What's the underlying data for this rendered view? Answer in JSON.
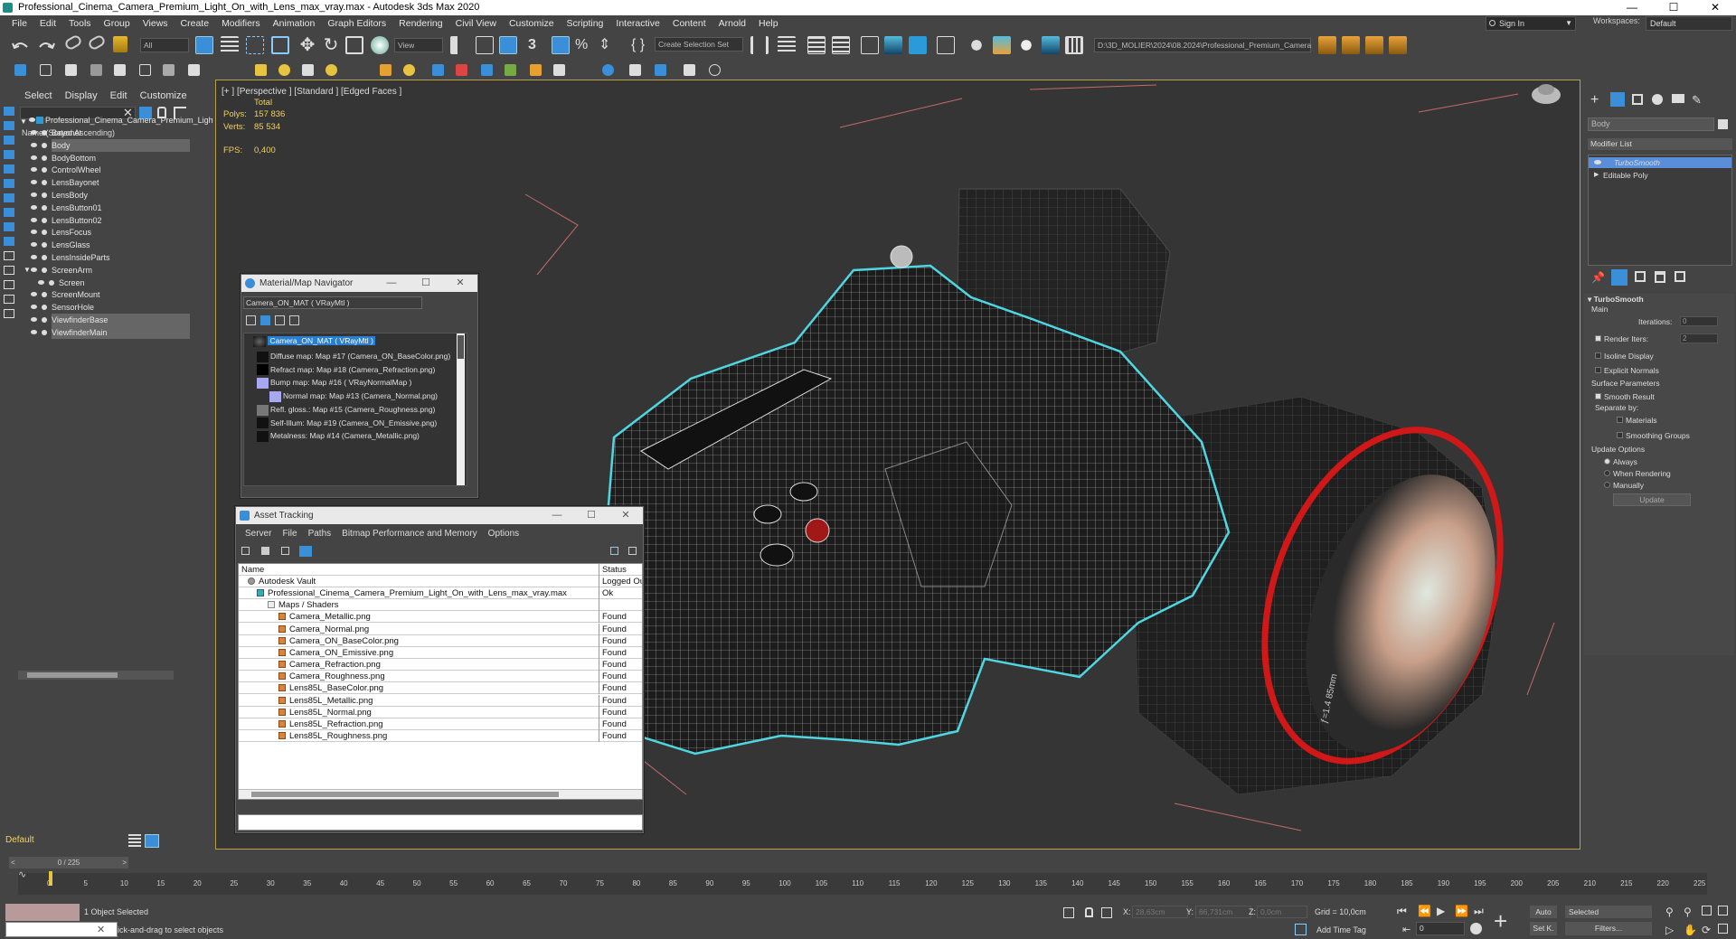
{
  "title": "Professional_Cinema_Camera_Premium_Light_On_with_Lens_max_vray.max - Autodesk 3ds Max 2020",
  "window_buttons": [
    "—",
    "☐",
    "✕"
  ],
  "menu": [
    "File",
    "Edit",
    "Tools",
    "Group",
    "Views",
    "Create",
    "Modifiers",
    "Animation",
    "Graph Editors",
    "Rendering",
    "Civil View",
    "Customize",
    "Scripting",
    "Interactive",
    "Content",
    "Arnold",
    "Help"
  ],
  "signin": "Sign In",
  "workspaces_label": "Workspaces:",
  "workspaces_value": "Default",
  "toolbar": {
    "filter": "All",
    "view": "View",
    "selection_set": "Create Selection Set",
    "path": "D:\\3D_MOLIER\\2024\\08.2024\\Professional_Premium_Camera"
  },
  "scene_explorer": {
    "tabs": [
      "Select",
      "Display",
      "Edit",
      "Customize"
    ],
    "header": "Name (Sorted Ascending)",
    "root": "Professional_Cinema_Camera_Premium_Light_On_with_Lens",
    "items": [
      {
        "name": "Bayonet",
        "selected": false
      },
      {
        "name": "Body",
        "selected": true
      },
      {
        "name": "BodyBottom",
        "selected": false
      },
      {
        "name": "ControlWheel",
        "selected": false
      },
      {
        "name": "LensBayonet",
        "selected": false
      },
      {
        "name": "LensBody",
        "selected": false
      },
      {
        "name": "LensButton01",
        "selected": false
      },
      {
        "name": "LensButton02",
        "selected": false
      },
      {
        "name": "LensFocus",
        "selected": false
      },
      {
        "name": "LensGlass",
        "selected": false
      },
      {
        "name": "LensInsideParts",
        "selected": false
      },
      {
        "name": "ScreenArm",
        "selected": false
      },
      {
        "name": "Screen",
        "selected": false
      },
      {
        "name": "ScreenMount",
        "selected": false
      },
      {
        "name": "SensorHole",
        "selected": false
      },
      {
        "name": "ViewfinderBase",
        "selected": true
      },
      {
        "name": "ViewfinderMain",
        "selected": true
      }
    ],
    "layer": "Default"
  },
  "viewport": {
    "label": "[+ ] [Perspective ] [Standard ] [Edged Faces ]",
    "total_label": "Total",
    "polys_label": "Polys:",
    "polys": "157 836",
    "verts_label": "Verts:",
    "verts": "85 534",
    "fps_label": "FPS:",
    "fps": "0,400",
    "lens_text": "ƒ=1.4  85mm"
  },
  "material_navigator": {
    "title": "Material/Map Navigator",
    "field": "Camera_ON_MAT  ( VRayMtl )",
    "root": "Camera_ON_MAT  ( VRayMtl )",
    "rows": [
      "Diffuse map: Map #17 (Camera_ON_BaseColor.png)",
      "Refract map: Map #18 (Camera_Refraction.png)",
      "Bump map: Map #16  ( VRayNormalMap )",
      "Normal map: Map #13 (Camera_Normal.png)",
      "Refl. gloss.: Map #15 (Camera_Roughness.png)",
      "Self-Illum: Map #19 (Camera_ON_Emissive.png)",
      "Metalness: Map #14 (Camera_Metallic.png)"
    ]
  },
  "asset_tracking": {
    "title": "Asset Tracking",
    "menu": [
      "Server",
      "File",
      "Paths",
      "Bitmap Performance and Memory",
      "Options"
    ],
    "col_name": "Name",
    "col_status": "Status",
    "rows": [
      {
        "name": "Autodesk Vault",
        "status": "Logged Ou",
        "level": 0
      },
      {
        "name": "Professional_Cinema_Camera_Premium_Light_On_with_Lens_max_vray.max",
        "status": "Ok",
        "level": 1
      },
      {
        "name": "Maps / Shaders",
        "status": "",
        "level": 2
      },
      {
        "name": "Camera_Metallic.png",
        "status": "Found",
        "level": 3
      },
      {
        "name": "Camera_Normal.png",
        "status": "Found",
        "level": 3
      },
      {
        "name": "Camera_ON_BaseColor.png",
        "status": "Found",
        "level": 3
      },
      {
        "name": "Camera_ON_Emissive.png",
        "status": "Found",
        "level": 3
      },
      {
        "name": "Camera_Refraction.png",
        "status": "Found",
        "level": 3
      },
      {
        "name": "Camera_Roughness.png",
        "status": "Found",
        "level": 3
      },
      {
        "name": "Lens85L_BaseColor.png",
        "status": "Found",
        "level": 3
      },
      {
        "name": "Lens85L_Metallic.png",
        "status": "Found",
        "level": 3
      },
      {
        "name": "Lens85L_Normal.png",
        "status": "Found",
        "level": 3
      },
      {
        "name": "Lens85L_Refraction.png",
        "status": "Found",
        "level": 3
      },
      {
        "name": "Lens85L_Roughness.png",
        "status": "Found",
        "level": 3
      }
    ]
  },
  "command_panel": {
    "object_name": "Body",
    "modifier_list": "Modifier List",
    "stack": [
      "TurboSmooth",
      "Editable Poly"
    ],
    "rollout": "TurboSmooth",
    "main": "Main",
    "iterations_label": "Iterations:",
    "iterations": "0",
    "render_iters_label": "Render Iters:",
    "render_iters": "2",
    "isoline": "Isoline Display",
    "explicit_normals": "Explicit Normals",
    "surface_params": "Surface Parameters",
    "smooth_result": "Smooth Result",
    "separate_by": "Separate by:",
    "materials": "Materials",
    "smoothing_groups": "Smoothing Groups",
    "update_options": "Update Options",
    "always": "Always",
    "when_rendering": "When Rendering",
    "manually": "Manually",
    "update_button": "Update"
  },
  "timeline": {
    "frame": "0 / 225",
    "ticks": [
      "0",
      "5",
      "10",
      "15",
      "20",
      "25",
      "30",
      "35",
      "40",
      "45",
      "50",
      "55",
      "60",
      "65",
      "70",
      "75",
      "80",
      "85",
      "90",
      "95",
      "100",
      "105",
      "110",
      "115",
      "120",
      "125",
      "130",
      "135",
      "140",
      "145",
      "150",
      "155",
      "160",
      "165",
      "170",
      "175",
      "180",
      "185",
      "190",
      "195",
      "200",
      "205",
      "210",
      "215",
      "220",
      "225"
    ]
  },
  "status": {
    "selected": "1 Object Selected",
    "prompt": "ick-and-drag to select objects",
    "x_label": "X:",
    "x": "28,63cm",
    "y_label": "Y:",
    "y": "66,731cm",
    "z_label": "Z:",
    "z": "0,0cm",
    "grid": "Grid = 10,0cm",
    "add_time_tag": "Add Time Tag",
    "auto": "Auto",
    "selected_combo": "Selected",
    "setk": "Set K.",
    "filters": "Filters...",
    "frame_field": "0"
  }
}
